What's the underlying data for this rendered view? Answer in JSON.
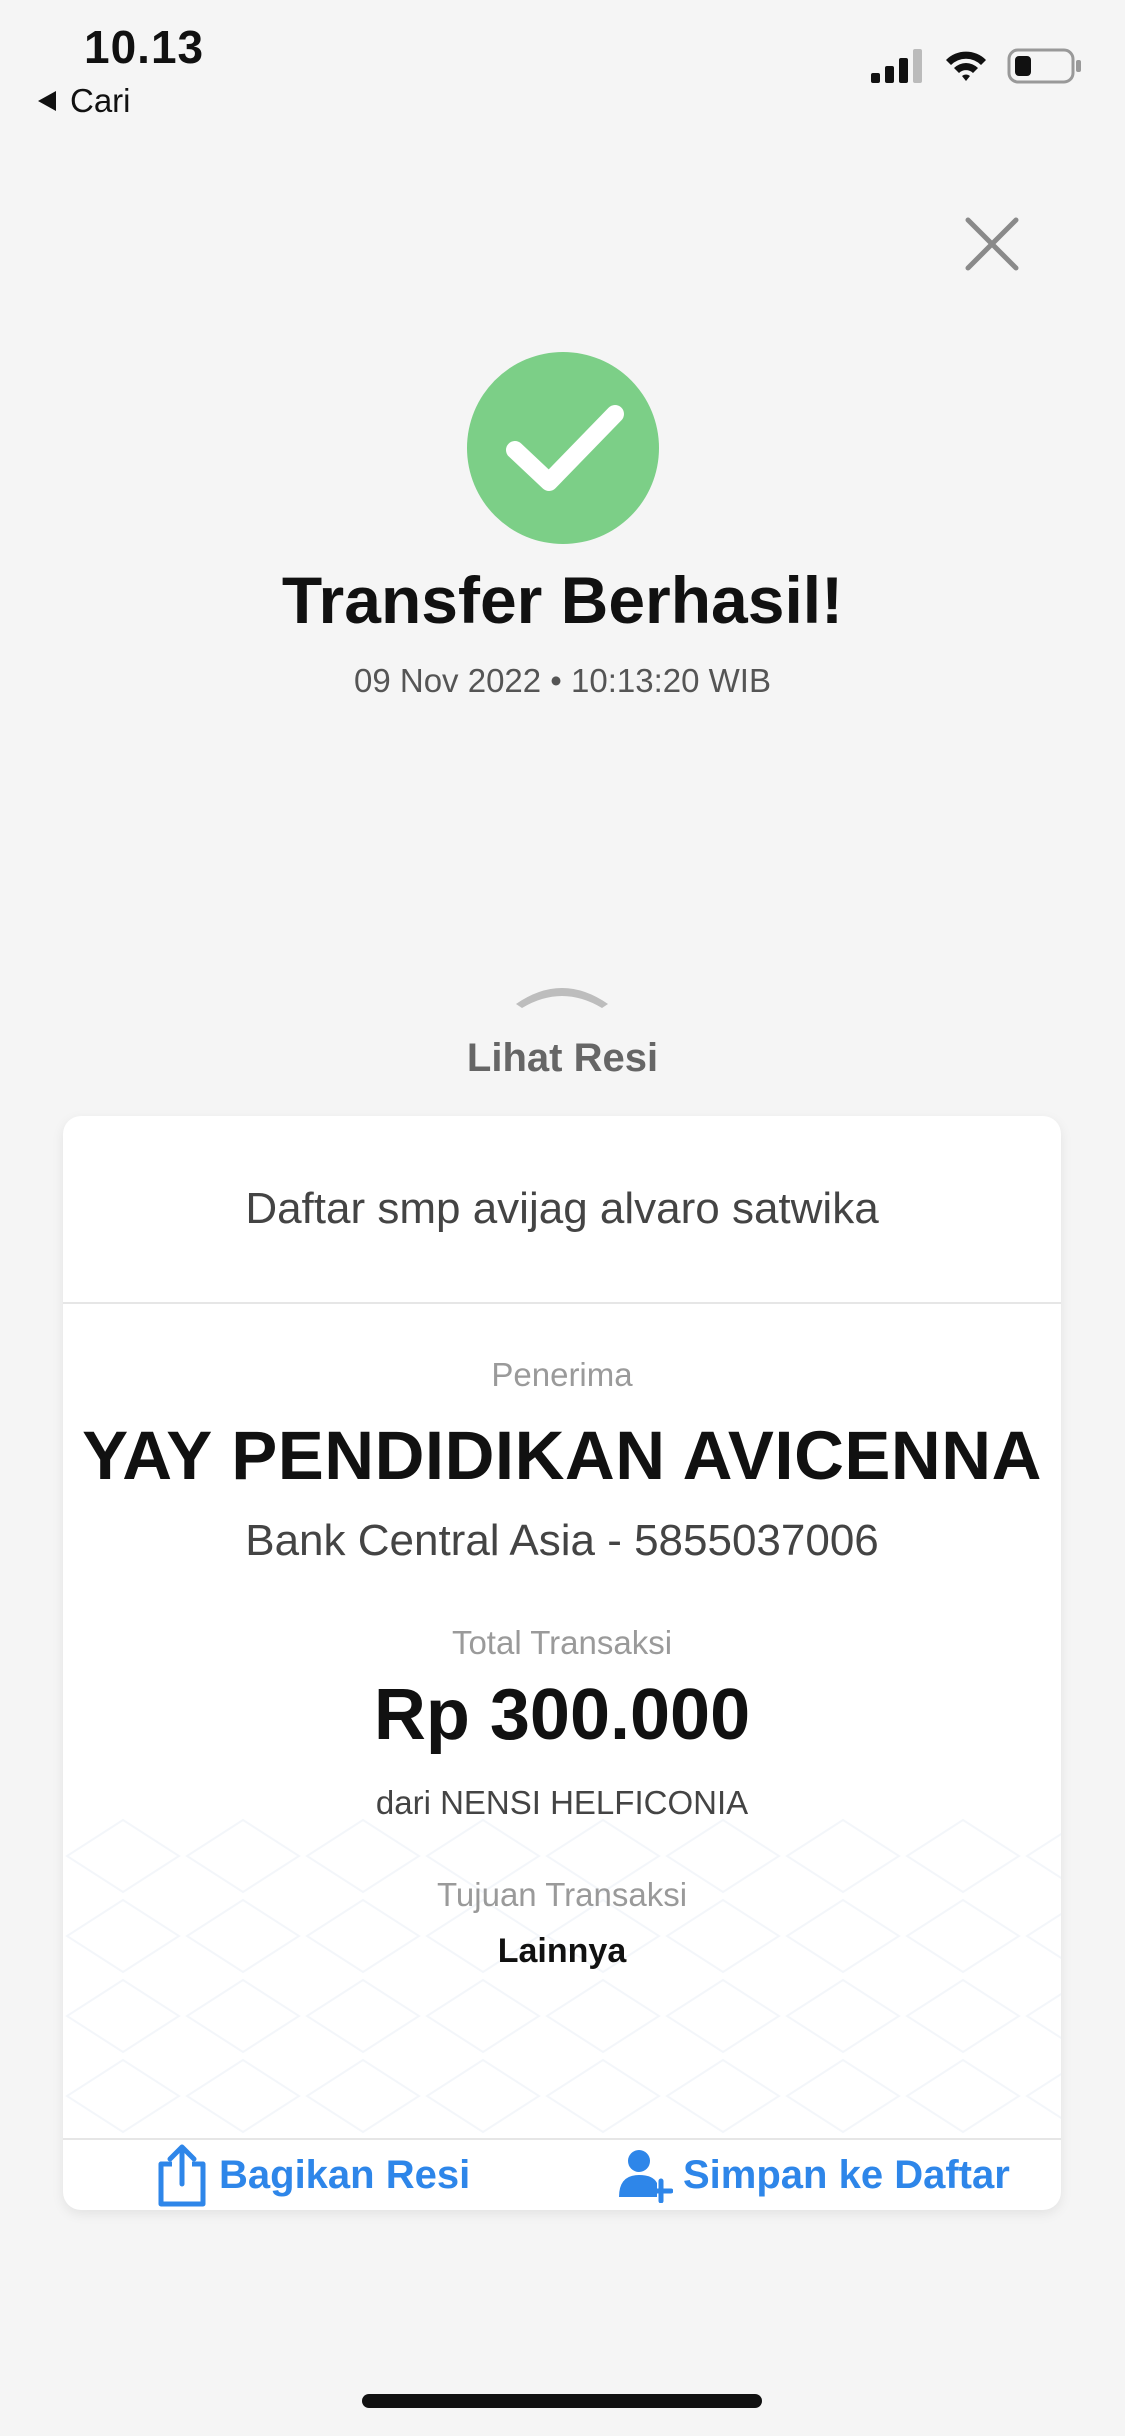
{
  "status_bar": {
    "time": "10.13",
    "back_label": "Cari"
  },
  "result": {
    "title": "Transfer Berhasil!",
    "datetime": "09 Nov 2022 • 10:13:20 WIB"
  },
  "receipt_toggle": {
    "label": "Lihat Resi"
  },
  "receipt": {
    "note": "Daftar smp avijag alvaro satwika",
    "recipient_label": "Penerima",
    "recipient_name": "YAY PENDIDIKAN AVICENNA",
    "recipient_bank": "Bank Central Asia - 5855037006",
    "total_label": "Total Transaksi",
    "amount": "Rp 300.000",
    "sender": "dari NENSI HELFICONIA",
    "purpose_label": "Tujuan Transaksi",
    "purpose": "Lainnya"
  },
  "actions": {
    "share_label": "Bagikan Resi",
    "save_label": "Simpan ke Daftar"
  },
  "colors": {
    "success_green": "#7ccf87",
    "action_blue": "#2e86e9",
    "background": "#f5f5f5"
  },
  "icons": [
    "signal-icon",
    "wifi-icon",
    "battery-icon",
    "close-icon",
    "check-icon",
    "chevron-up-icon",
    "share-icon",
    "add-user-icon"
  ]
}
